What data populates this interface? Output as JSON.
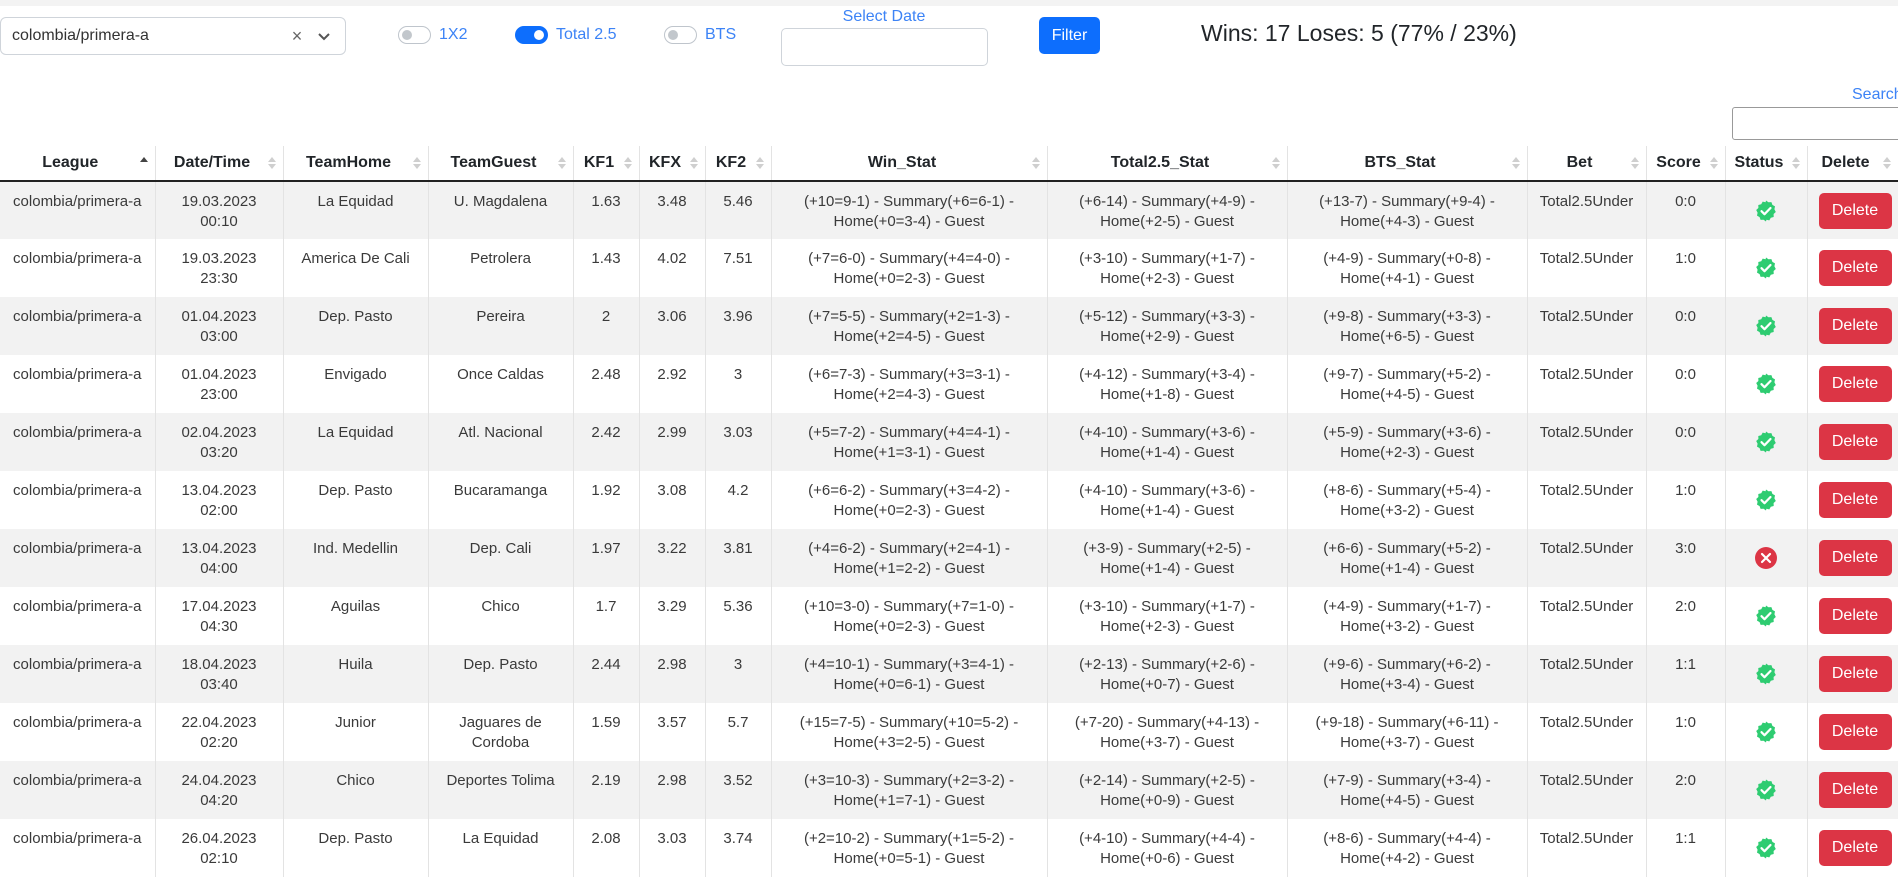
{
  "toolbar": {
    "league_value": "colombia/primera-a",
    "toggles": [
      {
        "label": "1X2",
        "on": false
      },
      {
        "label": "Total 2.5",
        "on": true
      },
      {
        "label": "BTS",
        "on": false
      }
    ],
    "date_label": "Select Date",
    "date_value": "",
    "filter_label": "Filter",
    "summary": "Wins: 17 Loses: 5 (77% / 23%)"
  },
  "search": {
    "label": "Search",
    "value": ""
  },
  "colors": {
    "accent": "#0d6efd",
    "link": "#3c83f6",
    "danger": "#dc3545",
    "success": "#2ecc71"
  },
  "table": {
    "columns": [
      "League",
      "Date/Time",
      "TeamHome",
      "TeamGuest",
      "KF1",
      "KFX",
      "KF2",
      "Win_Stat",
      "Total2.5_Stat",
      "BTS_Stat",
      "Bet",
      "Score",
      "Status",
      "Delete"
    ],
    "sorted_column": "League",
    "delete_label": "Delete",
    "rows": [
      {
        "league": "colombia/primera-a",
        "date": "19.03.2023",
        "time": "00:10",
        "home": "La Equidad",
        "guest": "U. Magdalena",
        "kf1": "1.63",
        "kfx": "3.48",
        "kf2": "5.46",
        "win1": "(+10=9-1) - Summary(+6=6-1) -",
        "win2": "Home(+0=3-4) - Guest",
        "tot1": "(+6-14) - Summary(+4-9) -",
        "tot2": "Home(+2-5) - Guest",
        "bts1": "(+13-7) - Summary(+9-4) -",
        "bts2": "Home(+4-3) - Guest",
        "bet": "Total2.5Under",
        "score": "0:0",
        "status": "win"
      },
      {
        "league": "colombia/primera-a",
        "date": "19.03.2023",
        "time": "23:30",
        "home": "America De Cali",
        "guest": "Petrolera",
        "kf1": "1.43",
        "kfx": "4.02",
        "kf2": "7.51",
        "win1": "(+7=6-0) - Summary(+4=4-0) -",
        "win2": "Home(+0=2-3) - Guest",
        "tot1": "(+3-10) - Summary(+1-7) -",
        "tot2": "Home(+2-3) - Guest",
        "bts1": "(+4-9) - Summary(+0-8) -",
        "bts2": "Home(+4-1) - Guest",
        "bet": "Total2.5Under",
        "score": "1:0",
        "status": "win"
      },
      {
        "league": "colombia/primera-a",
        "date": "01.04.2023",
        "time": "03:00",
        "home": "Dep. Pasto",
        "guest": "Pereira",
        "kf1": "2",
        "kfx": "3.06",
        "kf2": "3.96",
        "win1": "(+7=5-5) - Summary(+2=1-3) -",
        "win2": "Home(+2=4-5) - Guest",
        "tot1": "(+5-12) - Summary(+3-3) -",
        "tot2": "Home(+2-9) - Guest",
        "bts1": "(+9-8) - Summary(+3-3) -",
        "bts2": "Home(+6-5) - Guest",
        "bet": "Total2.5Under",
        "score": "0:0",
        "status": "win"
      },
      {
        "league": "colombia/primera-a",
        "date": "01.04.2023",
        "time": "23:00",
        "home": "Envigado",
        "guest": "Once Caldas",
        "kf1": "2.48",
        "kfx": "2.92",
        "kf2": "3",
        "win1": "(+6=7-3) - Summary(+3=3-1) -",
        "win2": "Home(+2=4-3) - Guest",
        "tot1": "(+4-12) - Summary(+3-4) -",
        "tot2": "Home(+1-8) - Guest",
        "bts1": "(+9-7) - Summary(+5-2) -",
        "bts2": "Home(+4-5) - Guest",
        "bet": "Total2.5Under",
        "score": "0:0",
        "status": "win"
      },
      {
        "league": "colombia/primera-a",
        "date": "02.04.2023",
        "time": "03:20",
        "home": "La Equidad",
        "guest": "Atl. Nacional",
        "kf1": "2.42",
        "kfx": "2.99",
        "kf2": "3.03",
        "win1": "(+5=7-2) - Summary(+4=4-1) -",
        "win2": "Home(+1=3-1) - Guest",
        "tot1": "(+4-10) - Summary(+3-6) -",
        "tot2": "Home(+1-4) - Guest",
        "bts1": "(+5-9) - Summary(+3-6) -",
        "bts2": "Home(+2-3) - Guest",
        "bet": "Total2.5Under",
        "score": "0:0",
        "status": "win"
      },
      {
        "league": "colombia/primera-a",
        "date": "13.04.2023",
        "time": "02:00",
        "home": "Dep. Pasto",
        "guest": "Bucaramanga",
        "kf1": "1.92",
        "kfx": "3.08",
        "kf2": "4.2",
        "win1": "(+6=6-2) - Summary(+3=4-2) -",
        "win2": "Home(+0=2-3) - Guest",
        "tot1": "(+4-10) - Summary(+3-6) -",
        "tot2": "Home(+1-4) - Guest",
        "bts1": "(+8-6) - Summary(+5-4) -",
        "bts2": "Home(+3-2) - Guest",
        "bet": "Total2.5Under",
        "score": "1:0",
        "status": "win"
      },
      {
        "league": "colombia/primera-a",
        "date": "13.04.2023",
        "time": "04:00",
        "home": "Ind. Medellin",
        "guest": "Dep. Cali",
        "kf1": "1.97",
        "kfx": "3.22",
        "kf2": "3.81",
        "win1": "(+4=6-2) - Summary(+2=4-1) -",
        "win2": "Home(+1=2-2) - Guest",
        "tot1": "(+3-9) - Summary(+2-5) -",
        "tot2": "Home(+1-4) - Guest",
        "bts1": "(+6-6) - Summary(+5-2) -",
        "bts2": "Home(+1-4) - Guest",
        "bet": "Total2.5Under",
        "score": "3:0",
        "status": "lose"
      },
      {
        "league": "colombia/primera-a",
        "date": "17.04.2023",
        "time": "04:30",
        "home": "Aguilas",
        "guest": "Chico",
        "kf1": "1.7",
        "kfx": "3.29",
        "kf2": "5.36",
        "win1": "(+10=3-0) - Summary(+7=1-0) -",
        "win2": "Home(+0=2-3) - Guest",
        "tot1": "(+3-10) - Summary(+1-7) -",
        "tot2": "Home(+2-3) - Guest",
        "bts1": "(+4-9) - Summary(+1-7) -",
        "bts2": "Home(+3-2) - Guest",
        "bet": "Total2.5Under",
        "score": "2:0",
        "status": "win"
      },
      {
        "league": "colombia/primera-a",
        "date": "18.04.2023",
        "time": "03:40",
        "home": "Huila",
        "guest": "Dep. Pasto",
        "kf1": "2.44",
        "kfx": "2.98",
        "kf2": "3",
        "win1": "(+4=10-1) - Summary(+3=4-1) -",
        "win2": "Home(+0=6-1) - Guest",
        "tot1": "(+2-13) - Summary(+2-6) -",
        "tot2": "Home(+0-7) - Guest",
        "bts1": "(+9-6) - Summary(+6-2) -",
        "bts2": "Home(+3-4) - Guest",
        "bet": "Total2.5Under",
        "score": "1:1",
        "status": "win"
      },
      {
        "league": "colombia/primera-a",
        "date": "22.04.2023",
        "time": "02:20",
        "home": "Junior",
        "guest": "Jaguares de Cordoba",
        "kf1": "1.59",
        "kfx": "3.57",
        "kf2": "5.7",
        "win1": "(+15=7-5) - Summary(+10=5-2) -",
        "win2": "Home(+3=2-5) - Guest",
        "tot1": "(+7-20) - Summary(+4-13) -",
        "tot2": "Home(+3-7) - Guest",
        "bts1": "(+9-18) - Summary(+6-11) -",
        "bts2": "Home(+3-7) - Guest",
        "bet": "Total2.5Under",
        "score": "1:0",
        "status": "win"
      },
      {
        "league": "colombia/primera-a",
        "date": "24.04.2023",
        "time": "04:20",
        "home": "Chico",
        "guest": "Deportes Tolima",
        "kf1": "2.19",
        "kfx": "2.98",
        "kf2": "3.52",
        "win1": "(+3=10-3) - Summary(+2=3-2) -",
        "win2": "Home(+1=7-1) - Guest",
        "tot1": "(+2-14) - Summary(+2-5) -",
        "tot2": "Home(+0-9) - Guest",
        "bts1": "(+7-9) - Summary(+3-4) -",
        "bts2": "Home(+4-5) - Guest",
        "bet": "Total2.5Under",
        "score": "2:0",
        "status": "win"
      },
      {
        "league": "colombia/primera-a",
        "date": "26.04.2023",
        "time": "02:10",
        "home": "Dep. Pasto",
        "guest": "La Equidad",
        "kf1": "2.08",
        "kfx": "3.03",
        "kf2": "3.74",
        "win1": "(+2=10-2) - Summary(+1=5-2) -",
        "win2": "Home(+0=5-1) - Guest",
        "tot1": "(+4-10) - Summary(+4-4) -",
        "tot2": "Home(+0-6) - Guest",
        "bts1": "(+8-6) - Summary(+4-4) -",
        "bts2": "Home(+4-2) - Guest",
        "bet": "Total2.5Under",
        "score": "1:1",
        "status": "win"
      }
    ]
  }
}
